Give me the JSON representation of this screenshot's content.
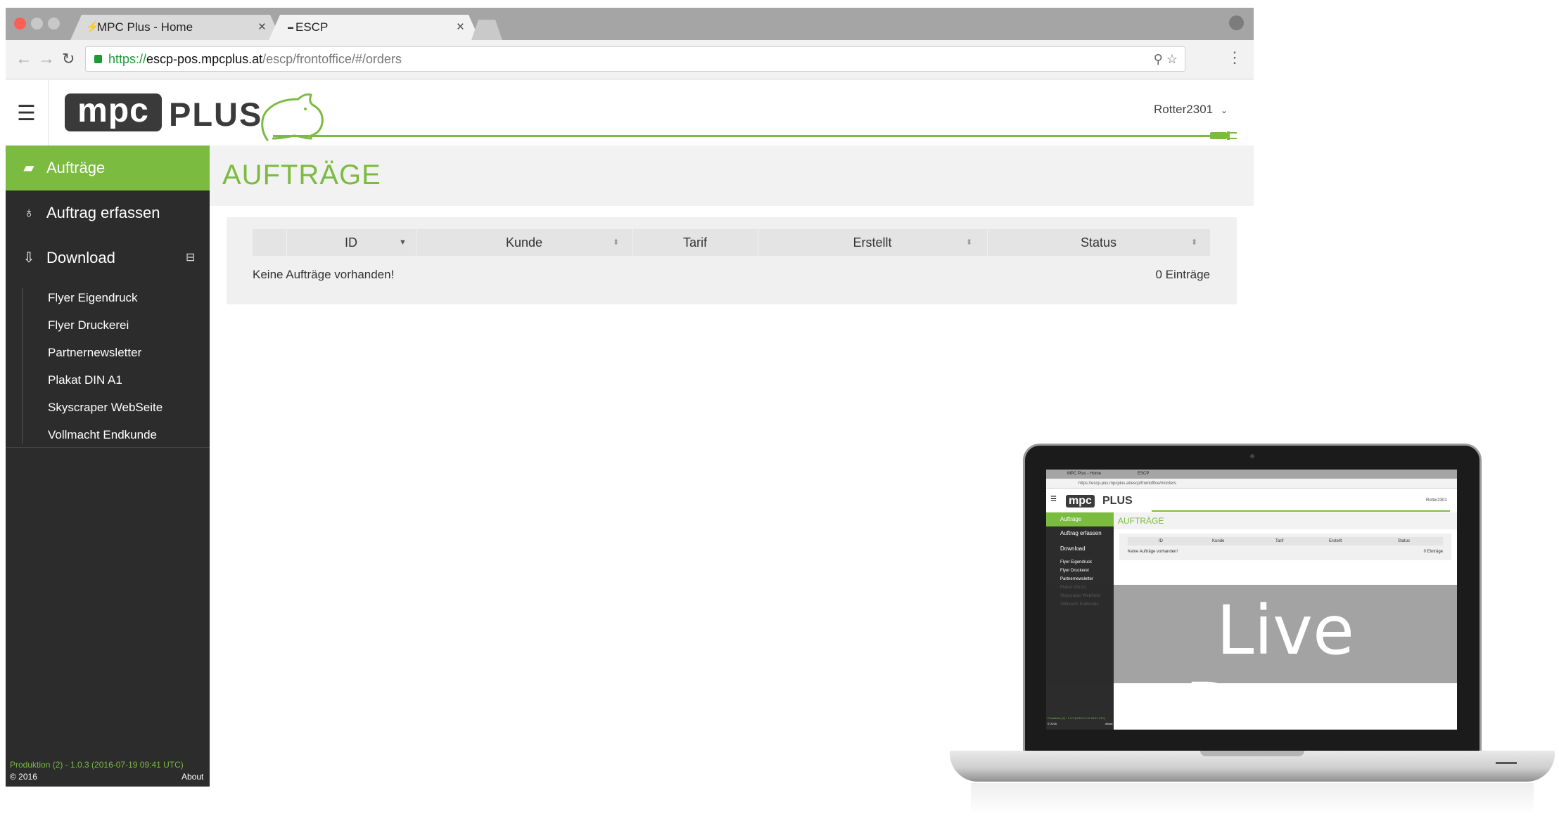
{
  "browser": {
    "tabs": [
      {
        "title": "MPC Plus - Home",
        "favicon": "mpc-leaf-icon"
      },
      {
        "title": "ESCP",
        "favicon": "mpc-plus-icon"
      }
    ],
    "url": {
      "scheme": "https://",
      "host": "escp-pos.mpcplus.at",
      "path": "/escp/frontoffice/#/orders"
    }
  },
  "app": {
    "logo": {
      "mpc": "mpc",
      "plus": "PLUS"
    },
    "user": "Rotter2301",
    "page_title": "AUFTRÄGE",
    "nav": [
      {
        "label": "Aufträge",
        "icon": "book-icon"
      },
      {
        "label": "Auftrag erfassen",
        "icon": "lightbulb-icon"
      },
      {
        "label": "Download",
        "icon": "download-icon"
      }
    ],
    "downloads": [
      "Flyer Eigendruck",
      "Flyer Druckerei",
      "Partnernewsletter",
      "Plakat DIN A1",
      "Skyscraper WebSeite",
      "Vollmacht Endkunde"
    ],
    "footer": {
      "version": "Produktion (2) - 1.0.3 (2016-07-19 09:41 UTC)",
      "copyright": "© 2016",
      "about": "About"
    },
    "table": {
      "columns": [
        "ID",
        "Kunde",
        "Tarif",
        "Erstellt",
        "Status"
      ],
      "empty_message": "Keine Aufträge vorhanden!",
      "count": "0 Einträge"
    }
  },
  "promo": {
    "label": "Live Demo"
  },
  "colors": {
    "accent": "#7bbb3f",
    "sidebar": "#2c2c2c",
    "band": "#f2f2f2"
  }
}
